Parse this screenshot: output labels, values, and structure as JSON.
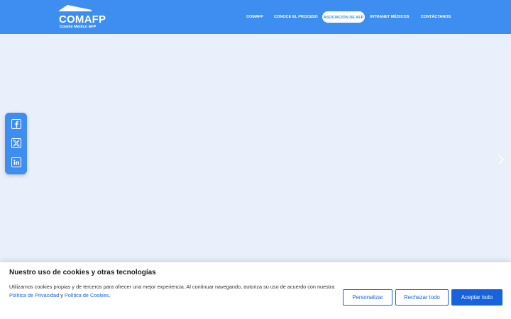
{
  "header": {
    "logo": {
      "name": "COMAFP",
      "subtitle": "Comité Médico AFP"
    },
    "nav": [
      {
        "label": "COMAFP"
      },
      {
        "label": "CONOCE EL PROCESO"
      },
      {
        "label": "ASOCIACIÓN DE AFP",
        "active": true
      },
      {
        "label": "INTRANET MÉDICOS"
      },
      {
        "label": "CONTÁCTANOS"
      }
    ]
  },
  "hero": {
    "next_icon": "chevron-right-icon"
  },
  "social": [
    {
      "icon": "facebook-icon"
    },
    {
      "icon": "x-twitter-icon"
    },
    {
      "icon": "linkedin-icon"
    }
  ],
  "cookie_banner": {
    "title": "Nuestro uso de cookies y otras tecnologías",
    "text": "Utilizamos cookies propias y de terceros para ofrecer una mejor experiencia. Al continuar navegando, autoriza su uso de acuerdo con nuestra",
    "privacy_link": "Política de Privacidad",
    "conjunction": " y ",
    "cookies_link": "Política de Cookies",
    "period": ".",
    "buttons": {
      "customize": "Personalizar",
      "reject": "Rechazar todo",
      "accept": "Aceptar todo"
    }
  },
  "colors": {
    "brand": "#3d8ef0",
    "hero_bg": "#e9effb",
    "cookie_accent": "#1863dc"
  }
}
